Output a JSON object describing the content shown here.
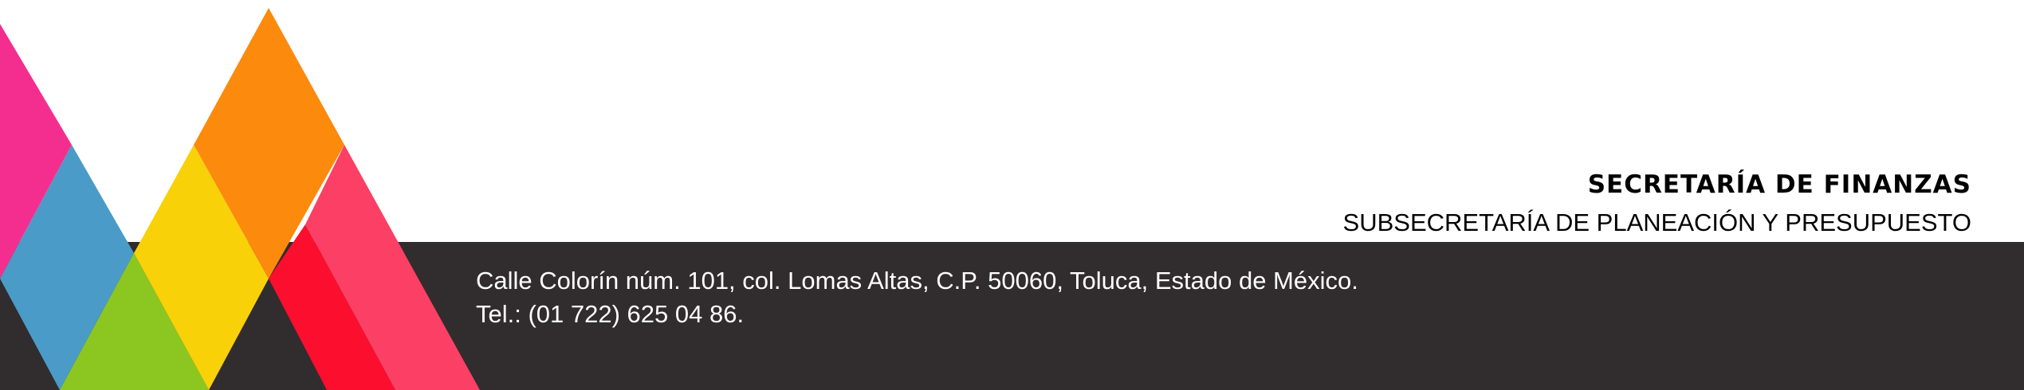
{
  "header": {
    "title": "SECRETARÍA DE FINANZAS",
    "subtitle": "SUBSECRETARÍA DE PLANEACIÓN Y PRESUPUESTO"
  },
  "footer": {
    "address": "Calle Colorín núm. 101, col. Lomas Altas, C.P. 50060, Toluca, Estado de México.",
    "phone": "Tel.: (01 722) 625 04 86."
  },
  "colors": {
    "band": "#312c2e",
    "magenta": "#f42e8f",
    "blue": "#4a9bc8",
    "green": "#8cc721",
    "yellow": "#f9d108",
    "orange": "#fc8a0c",
    "red": "#fb0e2e",
    "pink": "#fc3f64"
  }
}
